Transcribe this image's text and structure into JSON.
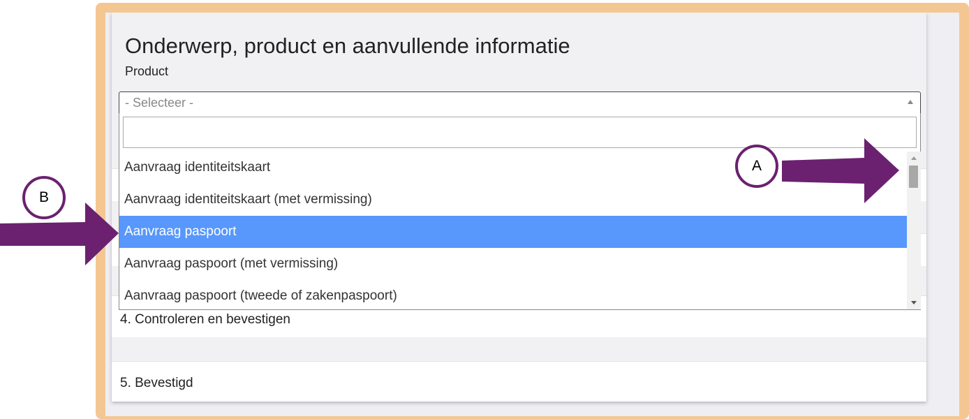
{
  "section": {
    "title": "Onderwerp, product en aanvullende informatie",
    "product_label": "Product"
  },
  "select": {
    "value": "- Selecteer -",
    "search_value": "",
    "options": [
      {
        "label": "Aanvraag identiteitskaart",
        "selected": false
      },
      {
        "label": "Aanvraag identiteitskaart (met vermissing)",
        "selected": false
      },
      {
        "label": "Aanvraag paspoort",
        "selected": true
      },
      {
        "label": "Aanvraag paspoort (met vermissing)",
        "selected": false
      },
      {
        "label": "Aanvraag paspoort (tweede of zakenpaspoort)",
        "selected": false
      }
    ]
  },
  "steps": {
    "step4": "4. Controleren en bevestigen",
    "step5": "5. Bevestigd"
  },
  "annotations": {
    "a_label": "A",
    "b_label": "B"
  },
  "colors": {
    "frame": "#f4c792",
    "arrow": "#6b2170",
    "selected": "#5897fb"
  }
}
